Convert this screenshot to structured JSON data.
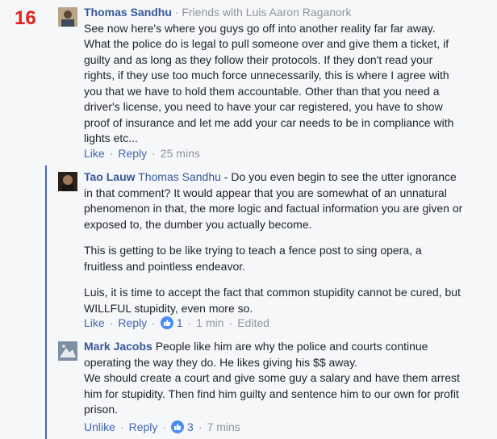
{
  "number_label": "16",
  "comments": [
    {
      "author": "Thomas Sandhu",
      "relation_sep": "·",
      "relation": "Friends with Luis Aaron Raganork",
      "text": "See now here's where you guys go off into another reality far far away. What the police do is legal to pull someone over and give them a ticket, if guilty and as long as they follow their protocols. If they don't read your rights, if they use too much force unnecessarily, this is where I agree with you that we have to hold them accountable. Other than that you need a driver's license, you need to have your car registered, you have to show proof of insurance and let me add your car needs to be in compliance with lights etc...",
      "actions": {
        "like": "Like",
        "sep1": "·",
        "reply": "Reply",
        "sep2": "·",
        "time": "25 mins"
      }
    },
    {
      "author": "Tao Lauw",
      "tag": "Thomas Sandhu",
      "paragraphs": [
        " - Do you even begin to see the utter ignorance in that comment? It would appear that you are somewhat of an unnatural phenomenon in that, the more logic and factual information you are given or exposed to, the dumber you actually become.",
        "This is getting to be like trying to teach a fence post to sing opera, a fruitless and pointless endeavor.",
        "Luis, it is time to accept the fact that common stupidity cannot be cured, but WILLFUL stupidity, even more so."
      ],
      "actions": {
        "like": "Like",
        "sep1": "·",
        "reply": "Reply",
        "sep2": "·",
        "reactions": "1",
        "sep3": "·",
        "time": "1 min",
        "sep4": "·",
        "edited": "Edited"
      }
    },
    {
      "author": "Mark Jacobs",
      "lines": [
        " People like him are why the police and courts continue operating the way they do. He likes giving his $$ away.",
        "We should create a court and give some guy a salary and have them arrest him for stupidity. Then find him guilty and sentence him to our own for profit prison."
      ],
      "actions": {
        "like": "Unlike",
        "sep1": "·",
        "reply": "Reply",
        "sep2": "·",
        "reactions": "3",
        "sep3": "·",
        "time": "7 mins"
      }
    }
  ],
  "colors": {
    "link": "#4267b2",
    "author": "#365899",
    "meta": "#90949c",
    "number": "#e0221b",
    "like_badge": "#4a8cf7"
  }
}
